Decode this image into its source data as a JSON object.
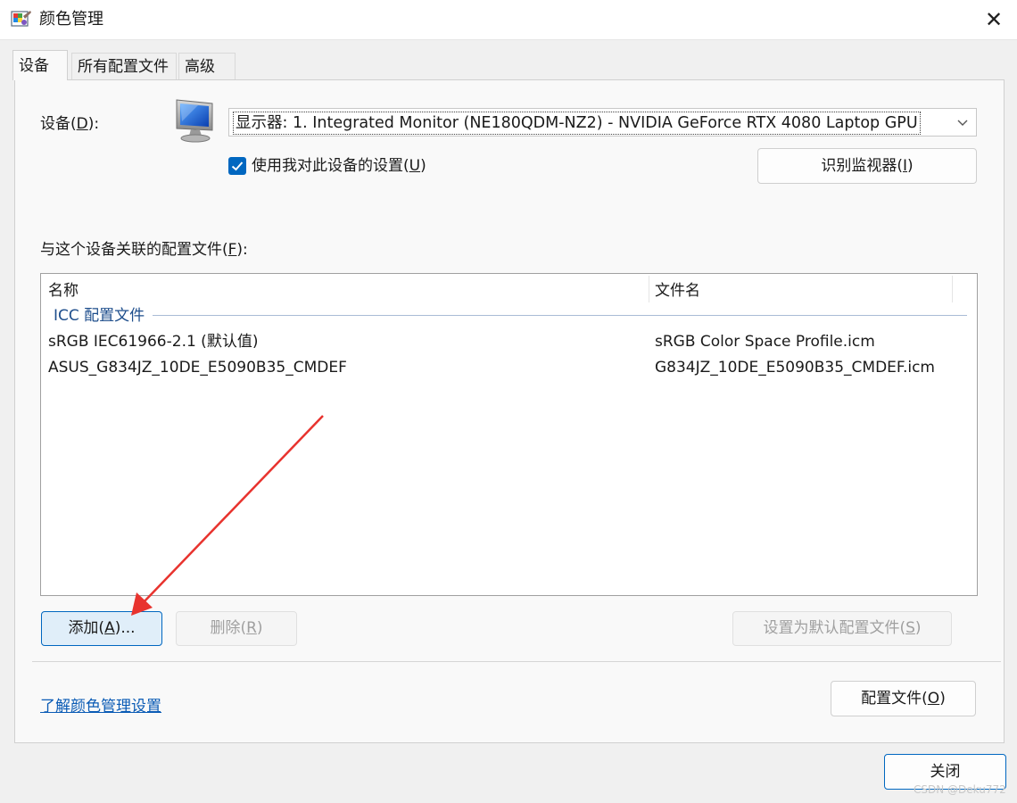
{
  "window": {
    "title": "颜色管理",
    "close_glyph": "✕"
  },
  "tabs": [
    {
      "label": "设备",
      "active": true
    },
    {
      "label": "所有配置文件"
    },
    {
      "label": "高级"
    }
  ],
  "device": {
    "label": "设备(D):",
    "selected": "显示器: 1. Integrated Monitor (NE180QDM-NZ2) - NVIDIA GeForce RTX 4080 Laptop GPU",
    "use_settings": {
      "label": "使用我对此设备的设置(U)",
      "checked": true
    },
    "identify_button": "识别监视器(I)"
  },
  "profiles": {
    "label": "与这个设备关联的配置文件(F):",
    "columns": [
      "名称",
      "文件名"
    ],
    "group": "ICC 配置文件",
    "rows": [
      {
        "name": "sRGB IEC61966-2.1 (默认值)",
        "file": "sRGB Color Space Profile.icm"
      },
      {
        "name": "ASUS_G834JZ_10DE_E5090B35_CMDEF",
        "file": "G834JZ_10DE_E5090B35_CMDEF.icm"
      }
    ]
  },
  "buttons": {
    "add": "添加(A)...",
    "remove": "删除(R)",
    "set_default": "设置为默认配置文件(S)",
    "profiles": "配置文件(O)",
    "close": "关闭"
  },
  "footer": {
    "learn_link": "了解颜色管理设置"
  },
  "watermark": "CSDN @Deku772",
  "colors": {
    "accent": "#0067c0",
    "annotation_arrow": "#e8332e",
    "link": "#0a5bb5"
  },
  "icons": [
    "color-management-app-icon",
    "monitor-icon",
    "chevron-down-icon",
    "checkmark-icon",
    "close-icon"
  ]
}
